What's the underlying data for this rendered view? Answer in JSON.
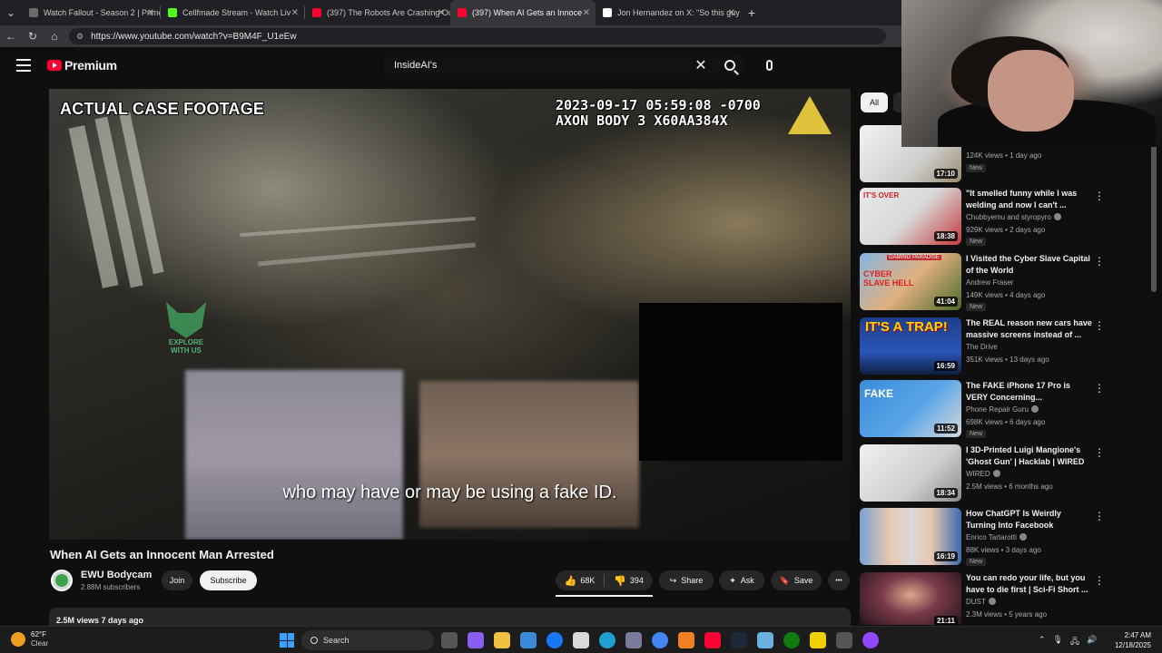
{
  "browser": {
    "tabs": [
      {
        "label": "Watch Fallout - Season 2 | Prime V",
        "color": "#6b6b6b"
      },
      {
        "label": "Cellfmade Stream - Watch Liv",
        "color": "#53fc18"
      },
      {
        "label": "(397) The Robots Are Crashing Ou",
        "color": "#ff0033"
      },
      {
        "label": "(397) When AI Gets an Innoce",
        "color": "#ff0033"
      },
      {
        "label": "Jon Hernandez on X: \"So this guy",
        "color": "#ffffff"
      }
    ],
    "new_tab": "+",
    "url": "https://www.youtube.com/watch?v=B9M4F_U1eEw"
  },
  "header": {
    "logo_text": "Premium",
    "search_value": "InsideAI's",
    "clear": "✕"
  },
  "player": {
    "headline": "ACTUAL CASE FOOTAGE",
    "stamp_line1": "2023-09-17 05:59:08 -0700",
    "stamp_line2": "AXON BODY 3 X60AA384X",
    "watermark": "EXPLORE WITH US",
    "caption": "who may have or may be using a fake ID."
  },
  "video": {
    "title": "When AI Gets an Innocent Man Arrested",
    "channel": "EWU Bodycam",
    "subscribers": "2.88M subscribers",
    "join_label": "Join",
    "subscribe_label": "Subscribe",
    "likes": "68K",
    "dislikes": "394",
    "share_label": "Share",
    "ask_label": "Ask",
    "save_label": "Save",
    "more": "•••",
    "views_line": "2.5M views  7 days ago"
  },
  "sidebar": {
    "chips": [
      "All",
      "A"
    ],
    "recs": [
      {
        "title": "",
        "channel": "",
        "meta": "124K views • 1 day ago",
        "new": "New",
        "duration": "17:10",
        "thumb": "#d9d9d9"
      },
      {
        "title": "\"It smelled funny while I was welding and now I can't ...",
        "channel": "Chubbyemu  and styropyro",
        "meta": "929K views • 2 days ago",
        "new": "New",
        "duration": "18:38",
        "thumb": "#3b3b3b"
      },
      {
        "title": "I Visited the Cyber Slave Capital of the World",
        "channel": "Andrew Fraser",
        "meta": "149K views • 4 days ago",
        "new": "New",
        "duration": "41:04",
        "thumb": "#5a6b3d"
      },
      {
        "title": "The REAL reason new cars have massive screens instead of ...",
        "channel": "The Drive",
        "meta": "351K views • 13 days ago",
        "new": "",
        "duration": "16:59",
        "thumb": "#2a4b9a"
      },
      {
        "title": "The FAKE iPhone 17 Pro is VERY Concerning...",
        "channel": "Phone Repair Guru",
        "meta": "698K views • 6 days ago",
        "new": "New",
        "duration": "11:52",
        "thumb": "#2b79c9"
      },
      {
        "title": "I 3D-Printed Luigi Mangione's 'Ghost Gun' | Hacklab | WIRED",
        "channel": "WIRED",
        "meta": "2.5M views • 6 months ago",
        "new": "",
        "duration": "18:34",
        "thumb": "#cfcfcf"
      },
      {
        "title": "How ChatGPT Is Weirdly Turning Into Facebook",
        "channel": "Enrico Tartarotti",
        "meta": "88K views • 3 days ago",
        "new": "New",
        "duration": "16:19",
        "thumb": "#7aa2d6"
      },
      {
        "title": "You can redo your life, but you have to die first | Sci-Fi Short ...",
        "channel": "DUST",
        "meta": "2.3M views • 5 years ago",
        "new": "",
        "duration": "21:11",
        "thumb": "#4a2a3a"
      }
    ],
    "thumb_texts": {
      "overlay_1": "IT'S OVER",
      "overlay_2": "CYBER SLAVE HELL",
      "overlay_3": "IT'S A TRAP!",
      "overlay_4": "FAKE",
      "overlay_2_top": "GAMING PARADISE"
    }
  },
  "taskbar": {
    "temp": "62°F",
    "condition": "Clear",
    "search_label": "Search",
    "time": "2:47 AM",
    "date": "12/18/2025"
  },
  "colors": {
    "accent": "#ff0033",
    "bg": "#0f0f0f"
  }
}
